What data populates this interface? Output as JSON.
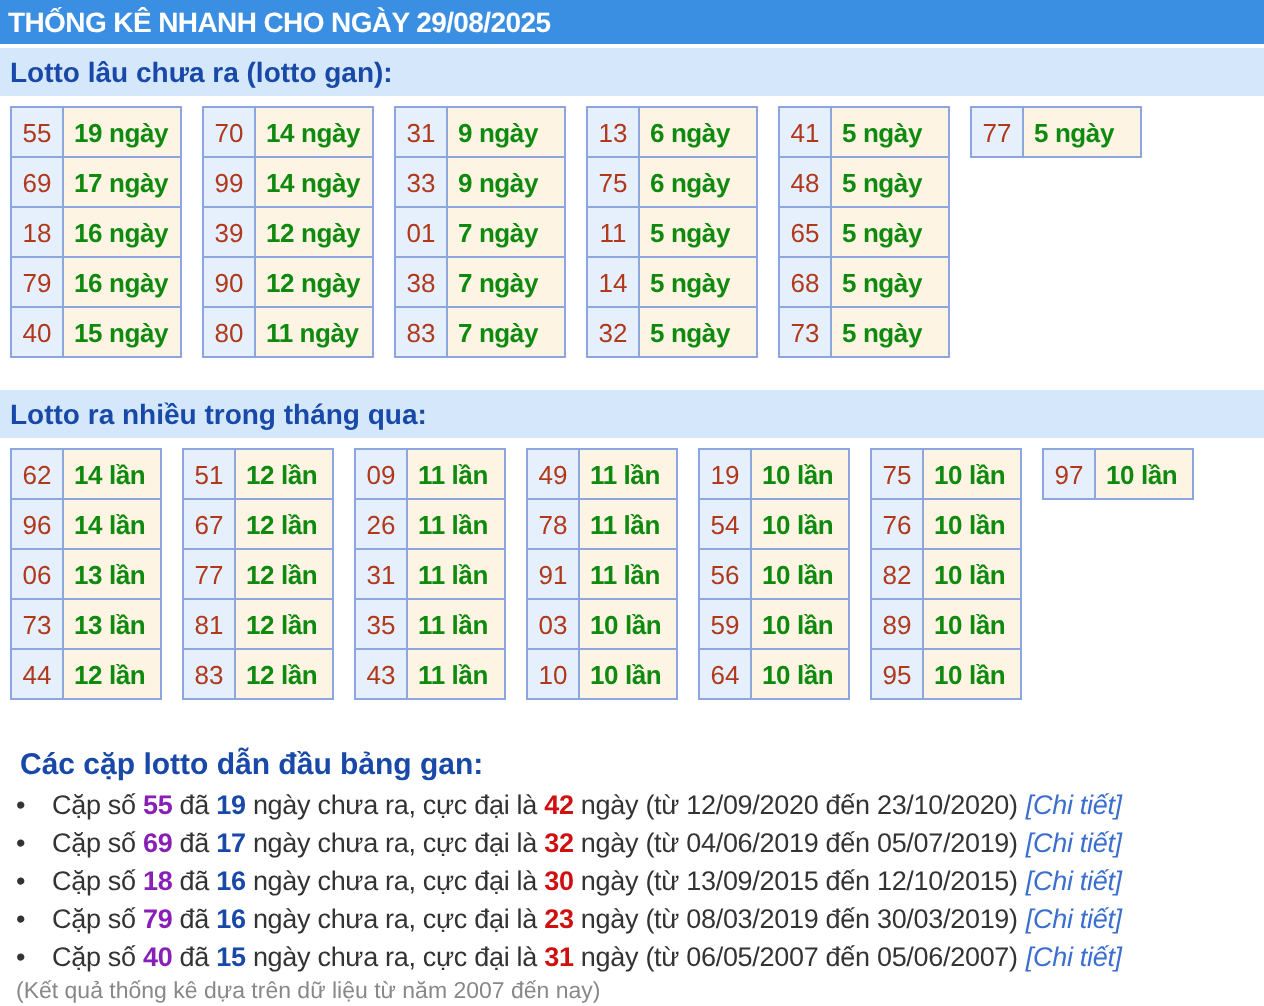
{
  "title": "THỐNG KÊ NHANH CHO NGÀY 29/08/2025",
  "gan": {
    "heading": "Lotto lâu chưa ra (lotto gan):",
    "tables": [
      [
        {
          "number": "55",
          "count": "19 ngày"
        },
        {
          "number": "69",
          "count": "17 ngày"
        },
        {
          "number": "18",
          "count": "16 ngày"
        },
        {
          "number": "79",
          "count": "16 ngày"
        },
        {
          "number": "40",
          "count": "15 ngày"
        }
      ],
      [
        {
          "number": "70",
          "count": "14 ngày"
        },
        {
          "number": "99",
          "count": "14 ngày"
        },
        {
          "number": "39",
          "count": "12 ngày"
        },
        {
          "number": "90",
          "count": "12 ngày"
        },
        {
          "number": "80",
          "count": "11 ngày"
        }
      ],
      [
        {
          "number": "31",
          "count": "9 ngày"
        },
        {
          "number": "33",
          "count": "9 ngày"
        },
        {
          "number": "01",
          "count": "7 ngày"
        },
        {
          "number": "38",
          "count": "7 ngày"
        },
        {
          "number": "83",
          "count": "7 ngày"
        }
      ],
      [
        {
          "number": "13",
          "count": "6 ngày"
        },
        {
          "number": "75",
          "count": "6 ngày"
        },
        {
          "number": "11",
          "count": "5 ngày"
        },
        {
          "number": "14",
          "count": "5 ngày"
        },
        {
          "number": "32",
          "count": "5 ngày"
        }
      ],
      [
        {
          "number": "41",
          "count": "5 ngày"
        },
        {
          "number": "48",
          "count": "5 ngày"
        },
        {
          "number": "65",
          "count": "5 ngày"
        },
        {
          "number": "68",
          "count": "5 ngày"
        },
        {
          "number": "73",
          "count": "5 ngày"
        }
      ],
      [
        {
          "number": "77",
          "count": "5 ngày"
        }
      ]
    ]
  },
  "frequent": {
    "heading": "Lotto ra nhiều trong tháng qua:",
    "tables": [
      [
        {
          "number": "62",
          "count": "14 lần"
        },
        {
          "number": "96",
          "count": "14 lần"
        },
        {
          "number": "06",
          "count": "13 lần"
        },
        {
          "number": "73",
          "count": "13 lần"
        },
        {
          "number": "44",
          "count": "12 lần"
        }
      ],
      [
        {
          "number": "51",
          "count": "12 lần"
        },
        {
          "number": "67",
          "count": "12 lần"
        },
        {
          "number": "77",
          "count": "12 lần"
        },
        {
          "number": "81",
          "count": "12 lần"
        },
        {
          "number": "83",
          "count": "12 lần"
        }
      ],
      [
        {
          "number": "09",
          "count": "11 lần"
        },
        {
          "number": "26",
          "count": "11 lần"
        },
        {
          "number": "31",
          "count": "11 lần"
        },
        {
          "number": "35",
          "count": "11 lần"
        },
        {
          "number": "43",
          "count": "11 lần"
        }
      ],
      [
        {
          "number": "49",
          "count": "11 lần"
        },
        {
          "number": "78",
          "count": "11 lần"
        },
        {
          "number": "91",
          "count": "11 lần"
        },
        {
          "number": "03",
          "count": "10 lần"
        },
        {
          "number": "10",
          "count": "10 lần"
        }
      ],
      [
        {
          "number": "19",
          "count": "10 lần"
        },
        {
          "number": "54",
          "count": "10 lần"
        },
        {
          "number": "56",
          "count": "10 lần"
        },
        {
          "number": "59",
          "count": "10 lần"
        },
        {
          "number": "64",
          "count": "10 lần"
        }
      ],
      [
        {
          "number": "75",
          "count": "10 lần"
        },
        {
          "number": "76",
          "count": "10 lần"
        },
        {
          "number": "82",
          "count": "10 lần"
        },
        {
          "number": "89",
          "count": "10 lần"
        },
        {
          "number": "95",
          "count": "10 lần"
        }
      ],
      [
        {
          "number": "97",
          "count": "10 lần"
        }
      ]
    ]
  },
  "leaders": {
    "heading": "Các cặp lotto dẫn đầu bảng gan:",
    "items": [
      {
        "segments": [
          {
            "kind": "text",
            "text": "Cặp số "
          },
          {
            "kind": "pair",
            "text": "55"
          },
          {
            "kind": "text",
            "text": " đã "
          },
          {
            "kind": "days",
            "text": "19"
          },
          {
            "kind": "text",
            "text": " ngày chưa ra, cực đại là "
          },
          {
            "kind": "max",
            "text": "42"
          },
          {
            "kind": "text",
            "text": " ngày (từ 12/09/2020 đến 23/10/2020)"
          }
        ],
        "marker": "•",
        "link": "[Chi tiết]"
      },
      {
        "segments": [
          {
            "kind": "text",
            "text": "Cặp số "
          },
          {
            "kind": "pair",
            "text": "69"
          },
          {
            "kind": "text",
            "text": " đã "
          },
          {
            "kind": "days",
            "text": "17"
          },
          {
            "kind": "text",
            "text": " ngày chưa ra, cực đại là "
          },
          {
            "kind": "max",
            "text": "32"
          },
          {
            "kind": "text",
            "text": " ngày (từ 04/06/2019 đến 05/07/2019)"
          }
        ],
        "marker": "•",
        "link": "[Chi tiết]"
      },
      {
        "segments": [
          {
            "kind": "text",
            "text": "Cặp số "
          },
          {
            "kind": "pair",
            "text": "18"
          },
          {
            "kind": "text",
            "text": " đã "
          },
          {
            "kind": "days",
            "text": "16"
          },
          {
            "kind": "text",
            "text": " ngày chưa ra, cực đại là "
          },
          {
            "kind": "max",
            "text": "30"
          },
          {
            "kind": "text",
            "text": " ngày (từ 13/09/2015 đến 12/10/2015)"
          }
        ],
        "marker": "•",
        "link": "[Chi tiết]"
      },
      {
        "segments": [
          {
            "kind": "text",
            "text": "Cặp số "
          },
          {
            "kind": "pair",
            "text": "79"
          },
          {
            "kind": "text",
            "text": " đã "
          },
          {
            "kind": "days",
            "text": "16"
          },
          {
            "kind": "text",
            "text": " ngày chưa ra, cực đại là "
          },
          {
            "kind": "max",
            "text": "23"
          },
          {
            "kind": "text",
            "text": " ngày (từ 08/03/2019 đến 30/03/2019)"
          }
        ],
        "marker": "•",
        "link": "[Chi tiết]"
      },
      {
        "segments": [
          {
            "kind": "text",
            "text": "Cặp số "
          },
          {
            "kind": "pair",
            "text": "40"
          },
          {
            "kind": "text",
            "text": " đã "
          },
          {
            "kind": "days",
            "text": "15"
          },
          {
            "kind": "text",
            "text": " ngày chưa ra, cực đại là "
          },
          {
            "kind": "max",
            "text": "31"
          },
          {
            "kind": "text",
            "text": " ngày (từ 06/05/2007 đến 05/06/2007)"
          }
        ],
        "marker": "•",
        "link": "[Chi tiết]"
      }
    ]
  },
  "footnote": "(Kết quả thống kê dựa trên dữ liệu từ năm 2007 đến nay)"
}
